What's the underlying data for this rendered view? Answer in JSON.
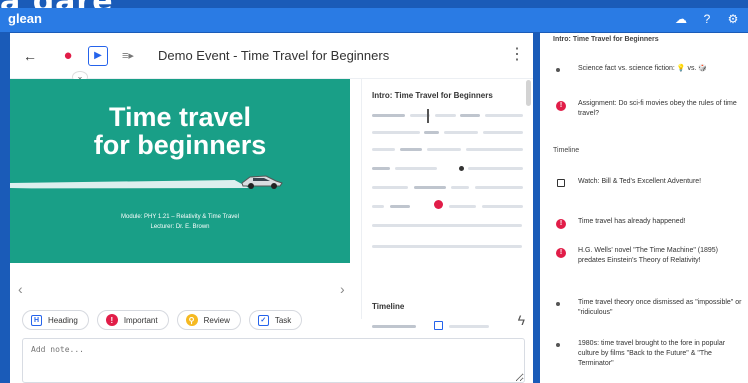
{
  "hero": {
    "text": "a dare"
  },
  "app": {
    "brand": "glean",
    "top_icons": [
      "cloud-icon",
      "help-icon",
      "settings-icon"
    ]
  },
  "toolbar": {
    "title": "Demo Event - Time Travel for Beginners",
    "icons": [
      "back-arrow-icon",
      "microphone-icon",
      "play-icon",
      "skip-icon",
      "more-vertical-icon"
    ],
    "play_label": "▶",
    "skip_label": "≡▸"
  },
  "slide": {
    "title_line_1": "Time travel",
    "title_line_2": "for beginners",
    "module": "Module: PHY 1.21 – Relativity & Time Travel",
    "lecturer": "Lecturer: Dr. E. Brown"
  },
  "navigation": {
    "previous": "‹",
    "next": "›"
  },
  "outline": {
    "heading": "Intro: Time Travel for Beginners",
    "timeline": "Timeline"
  },
  "annotations": {
    "heading": "Heading",
    "important": "Important",
    "review": "Review",
    "task": "Task"
  },
  "note": {
    "placeholder": "Add note..."
  },
  "notes": {
    "section_title": "Intro: Time Travel for Beginners",
    "items": [
      {
        "kind": "bullet",
        "text": "Science fact vs. science fiction: 💡 vs. 🎲"
      },
      {
        "kind": "important",
        "text": "Assignment: Do sci-fi movies obey the rules of time travel?"
      },
      {
        "kind": "section",
        "text": "Timeline"
      },
      {
        "kind": "task",
        "text": "Watch: Bill & Ted's Excellent Adventure!"
      },
      {
        "kind": "important",
        "text": "Time travel has already happened!"
      },
      {
        "kind": "important",
        "text": "H.G. Wells' novel \"The Time Machine\" (1895) predates Einstein's Theory of Relativity!"
      },
      {
        "kind": "bullet",
        "text": "Time travel theory once dismissed as \"impossible\" or \"ridiculous\""
      },
      {
        "kind": "bullet",
        "text": "1980s: time travel brought to the fore in popular culture by films \"Back to the Future\" & \"The Terminator\""
      }
    ]
  },
  "colors": {
    "topbar": "#2a7be4",
    "slide_background": "#199f87",
    "accent_blue": "#2563eb",
    "important_red": "#e11d48",
    "review_yellow": "#f5b921"
  }
}
